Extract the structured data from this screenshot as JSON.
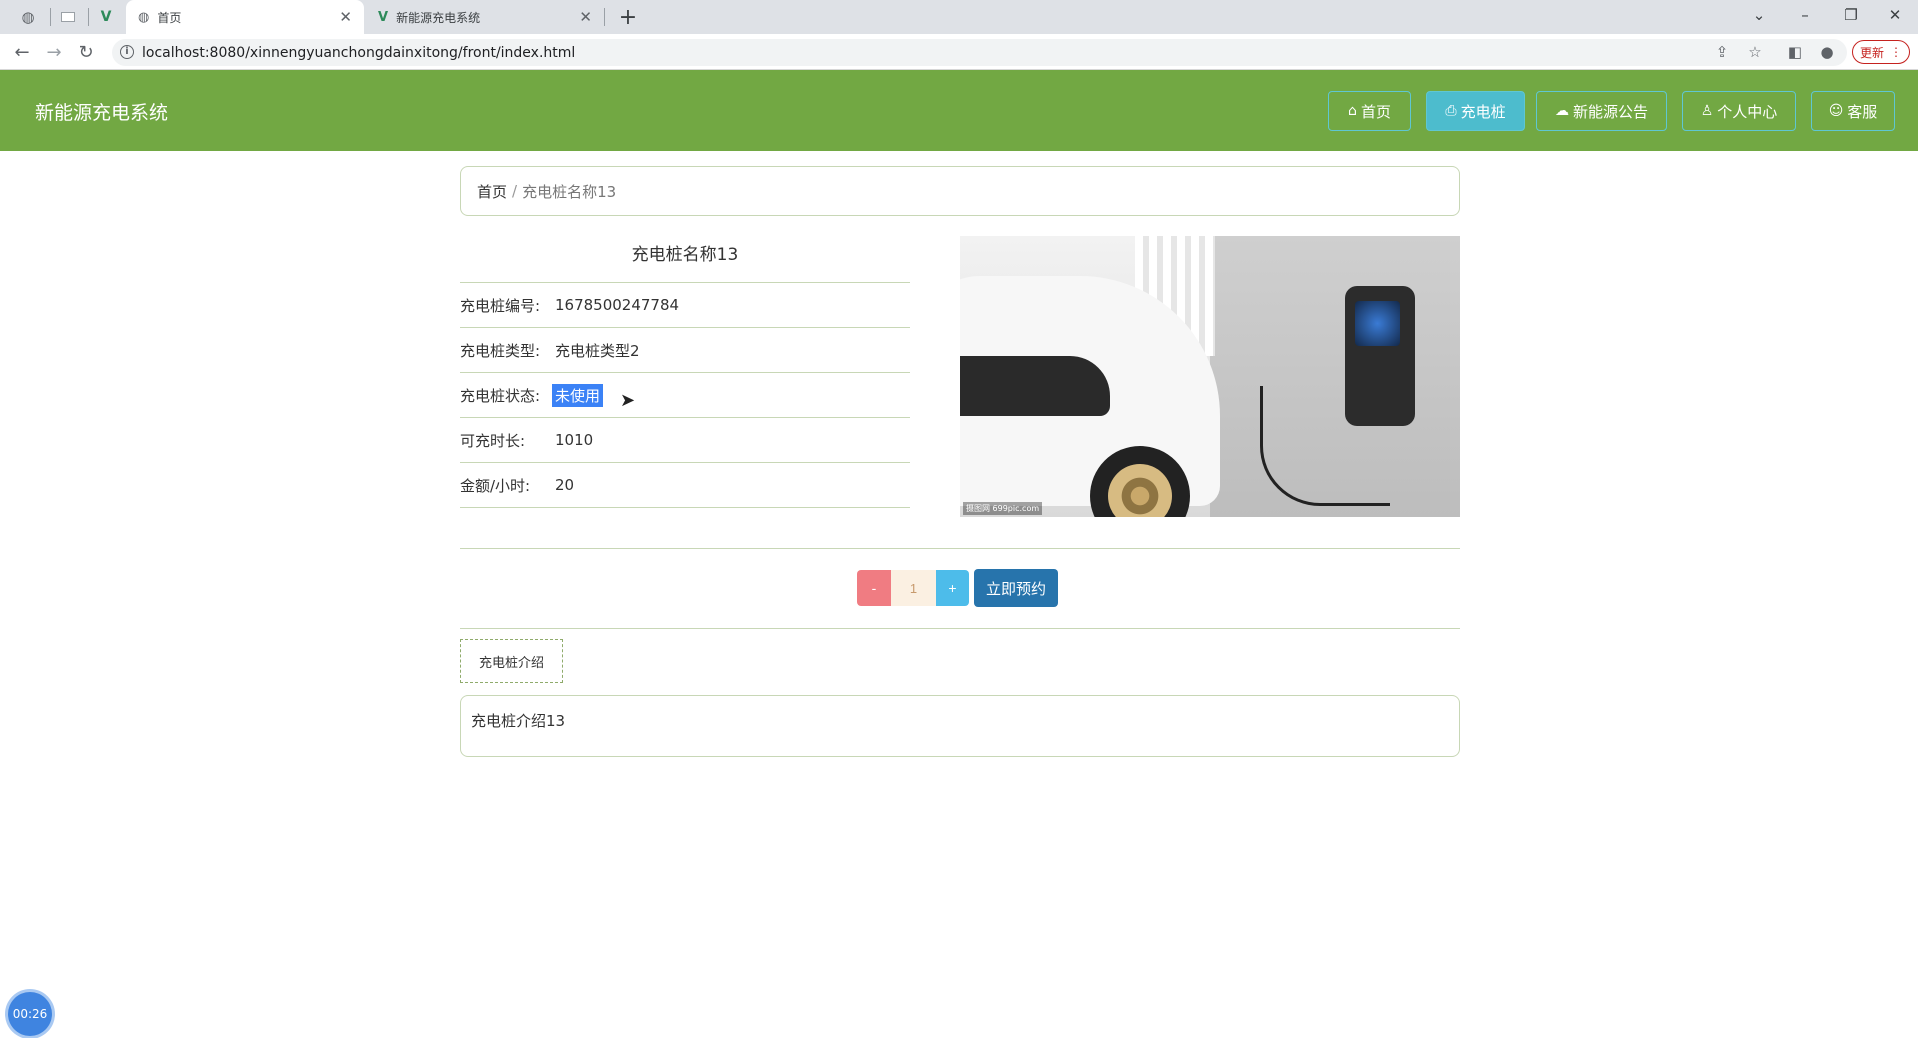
{
  "browser": {
    "tabs": [
      {
        "title": "首页",
        "icon": "globe-icon",
        "active": true
      },
      {
        "title": "新能源充电系统",
        "icon": "vue-logo-icon",
        "active": false
      }
    ],
    "url": "localhost:8080/xinnengyuanchongdainxitong/front/index.html",
    "update_label": "更新"
  },
  "header": {
    "site_title": "新能源充电系统",
    "nav": [
      {
        "label": "首页",
        "icon": "home-icon"
      },
      {
        "label": "充电桩",
        "icon": "charger-icon"
      },
      {
        "label": "新能源公告",
        "icon": "announcement-icon"
      },
      {
        "label": "个人中心",
        "icon": "user-icon"
      },
      {
        "label": "客服",
        "icon": "support-icon"
      }
    ],
    "accent": "#72a843"
  },
  "breadcrumb": {
    "home": "首页",
    "separator": "/",
    "current": "充电桩名称13"
  },
  "detail": {
    "title": "充电桩名称13",
    "fields": [
      {
        "label": "充电桩编号:",
        "value": "1678500247784"
      },
      {
        "label": "充电桩类型:",
        "value": "充电桩类型2"
      },
      {
        "label": "充电桩状态:",
        "value": "未使用"
      },
      {
        "label": "可充时长:",
        "value": "1010"
      },
      {
        "label": "金额/小时:",
        "value": "20"
      }
    ],
    "image_watermark": "摄图网 699pic.com"
  },
  "booking": {
    "minus": "-",
    "quantity": "1",
    "plus": "+",
    "book_label": "立即预约"
  },
  "intro": {
    "tab_label": "充电桩介绍",
    "content": "充电桩介绍13"
  },
  "recorder": {
    "time": "00:26"
  }
}
